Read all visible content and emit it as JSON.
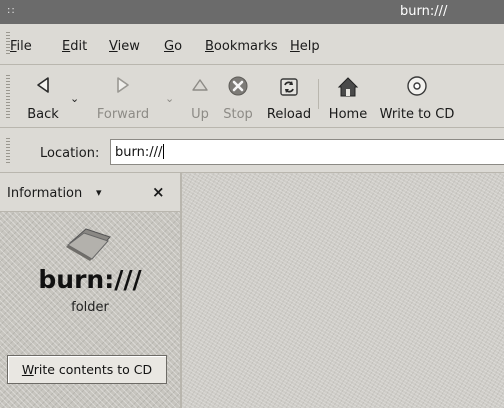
{
  "window": {
    "title": "burn:///",
    "grip": "::"
  },
  "menubar": {
    "items": [
      {
        "key": "F",
        "rest": "ile"
      },
      {
        "key": "E",
        "rest": "dit"
      },
      {
        "key": "V",
        "rest": "iew"
      },
      {
        "key": "G",
        "rest": "o"
      },
      {
        "key": "B",
        "rest": "ookmarks"
      },
      {
        "key": "H",
        "rest": "elp"
      }
    ]
  },
  "toolbar": {
    "back": "Back",
    "forward": "Forward",
    "up": "Up",
    "stop": "Stop",
    "reload": "Reload",
    "home": "Home",
    "write_to_cd": "Write to CD",
    "dropdown_glyph": "⌄"
  },
  "location": {
    "label": "Location:",
    "value": "burn:///"
  },
  "sidepane": {
    "title": "Information",
    "chevron": "▾",
    "close": "×",
    "name": "burn:///",
    "type": "folder",
    "button_key": "W",
    "button_rest": "rite contents to CD"
  },
  "icons": {
    "back": "back-arrow-icon",
    "forward": "forward-arrow-icon",
    "up": "up-arrow-icon",
    "stop": "stop-icon",
    "reload": "reload-icon",
    "home": "home-icon",
    "cd": "cd-icon",
    "folder": "folder-icon"
  }
}
